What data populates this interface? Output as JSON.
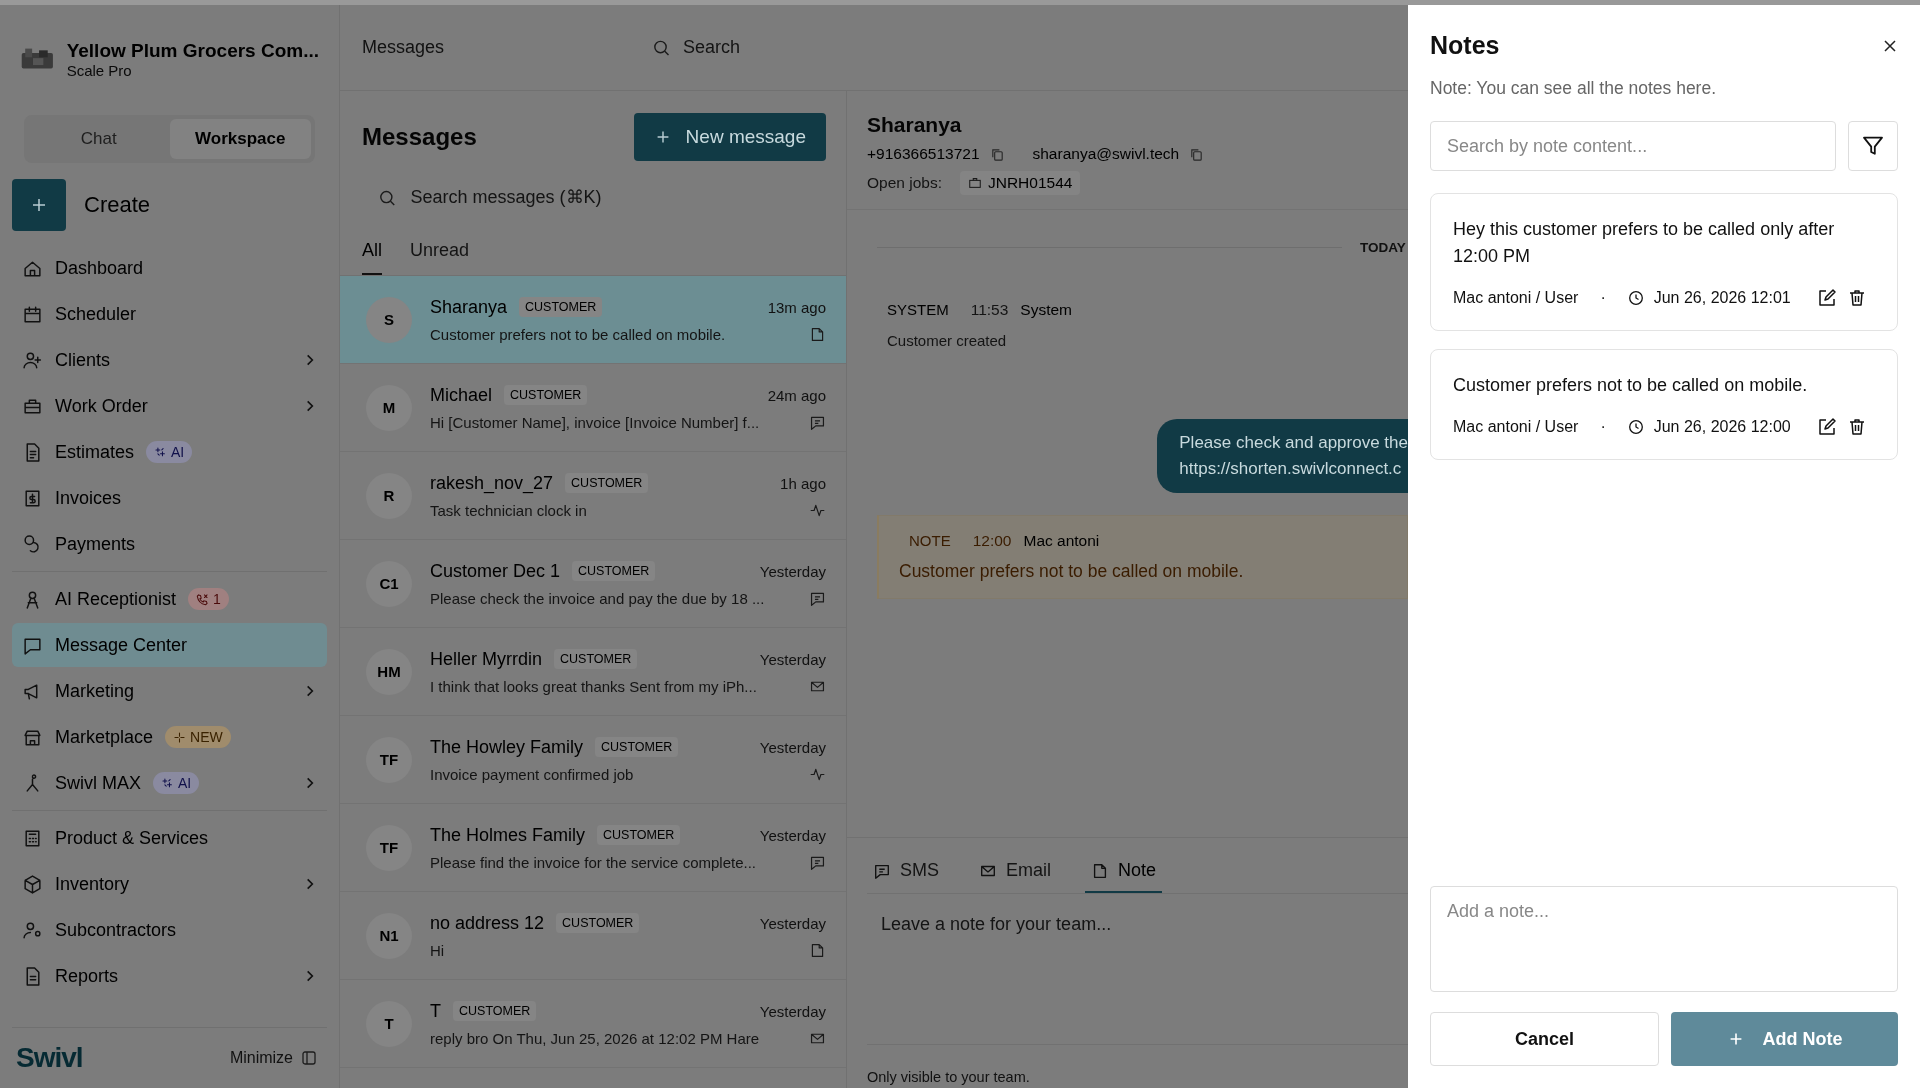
{
  "sidebar": {
    "company": {
      "name": "Yellow Plum Grocers Com...",
      "plan": "Scale Pro"
    },
    "mode_tabs": [
      {
        "label": "Chat",
        "selected": false
      },
      {
        "label": "Workspace",
        "selected": true
      }
    ],
    "create_button": "Create",
    "nav_groups": [
      [
        {
          "label": "Dashboard",
          "expandable": false,
          "selected": false
        },
        {
          "label": "Scheduler",
          "expandable": false,
          "selected": false
        },
        {
          "label": "Clients",
          "expandable": true,
          "selected": false
        },
        {
          "label": "Work Order",
          "expandable": true,
          "selected": false
        },
        {
          "label": "Estimates",
          "expandable": false,
          "selected": false,
          "badge": {
            "kind": "ai",
            "text": "AI"
          }
        },
        {
          "label": "Invoices",
          "expandable": false,
          "selected": false
        },
        {
          "label": "Payments",
          "expandable": false,
          "selected": false
        }
      ],
      [
        {
          "label": "AI Receptionist",
          "expandable": false,
          "selected": false,
          "badge": {
            "kind": "call",
            "text": "1"
          }
        },
        {
          "label": "Message Center",
          "expandable": false,
          "selected": true
        },
        {
          "label": "Marketing",
          "expandable": true,
          "selected": false
        },
        {
          "label": "Marketplace",
          "expandable": false,
          "selected": false,
          "badge": {
            "kind": "new",
            "text": "NEW"
          }
        },
        {
          "label": "Swivl MAX",
          "expandable": true,
          "selected": false,
          "badge": {
            "kind": "ai",
            "text": "AI"
          }
        }
      ],
      [
        {
          "label": "Product & Services",
          "expandable": false,
          "selected": false
        },
        {
          "label": "Inventory",
          "expandable": true,
          "selected": false
        },
        {
          "label": "Subcontractors",
          "expandable": false,
          "selected": false
        },
        {
          "label": "Reports",
          "expandable": true,
          "selected": false
        }
      ]
    ],
    "logo": "Swivl",
    "minimize": "Minimize"
  },
  "top_bar": {
    "breadcrumb": "Messages",
    "search": {
      "placeholder": "Search"
    }
  },
  "messages": {
    "title": "Messages",
    "new_button": "New message",
    "search": {
      "placeholder": "Search messages (⌘K)"
    },
    "filter_tabs": [
      {
        "label": "All",
        "selected": true
      },
      {
        "label": "Unread",
        "selected": false
      }
    ],
    "conversations": [
      {
        "initials": "S",
        "name": "Sharanya",
        "tag": "CUSTOMER",
        "time": "13m ago",
        "preview": "Customer prefers not to be called on mobile.",
        "kind": "note",
        "selected": true
      },
      {
        "initials": "M",
        "name": "Michael",
        "tag": "CUSTOMER",
        "time": "24m ago",
        "preview": "Hi [Customer Name], invoice [Invoice Number] f...",
        "kind": "sms",
        "selected": false
      },
      {
        "initials": "R",
        "name": "rakesh_nov_27",
        "tag": "CUSTOMER",
        "time": "1h ago",
        "preview": "Task technician clock in",
        "kind": "activity",
        "selected": false
      },
      {
        "initials": "C1",
        "name": "Customer Dec 1",
        "tag": "CUSTOMER",
        "time": "Yesterday",
        "preview": "Please check the invoice and pay the due by 18 ...",
        "kind": "sms",
        "selected": false
      },
      {
        "initials": "HM",
        "name": "Heller Myrrdin",
        "tag": "CUSTOMER",
        "time": "Yesterday",
        "preview": "I think that looks great thanks Sent from my iPh...",
        "kind": "email",
        "selected": false
      },
      {
        "initials": "TF",
        "name": "The Howley Family",
        "tag": "CUSTOMER",
        "time": "Yesterday",
        "preview": "Invoice payment confirmed job",
        "kind": "activity",
        "selected": false
      },
      {
        "initials": "TF",
        "name": "The Holmes Family",
        "tag": "CUSTOMER",
        "time": "Yesterday",
        "preview": "Please find the invoice for the service complete...",
        "kind": "sms",
        "selected": false
      },
      {
        "initials": "N1",
        "name": "no address 12",
        "tag": "CUSTOMER",
        "time": "Yesterday",
        "preview": "Hi",
        "kind": "note",
        "selected": false
      },
      {
        "initials": "T",
        "name": "T",
        "tag": "CUSTOMER",
        "time": "Yesterday",
        "preview": "reply bro On Thu, Jun 25, 2026 at 12:02 PM Hare",
        "kind": "email",
        "selected": false
      }
    ]
  },
  "conversation": {
    "contact": {
      "name": "Sharanya",
      "phone": "+916366513721",
      "email": "sharanya@swivl.tech",
      "open_jobs_label": "Open jobs:",
      "job": "JNRH01544"
    },
    "day_divider": "TODAY",
    "events": [
      {
        "kind": "system",
        "tag": "SYSTEM",
        "time": "11:53",
        "author": "System",
        "text": "Customer created"
      },
      {
        "kind": "outgoing",
        "lines": [
          "Please check and approve the",
          "https://shorten.swivlconnect.c"
        ]
      },
      {
        "kind": "note",
        "tag": "NOTE",
        "time": "12:00",
        "author": "Mac antoni",
        "text": "Customer prefers not to be called on mobile."
      }
    ],
    "composer_tabs": [
      {
        "label": "SMS",
        "kind": "sms",
        "selected": false
      },
      {
        "label": "Email",
        "kind": "email",
        "selected": false
      },
      {
        "label": "Note",
        "kind": "note",
        "selected": true
      }
    ],
    "composer": {
      "placeholder": "Leave a note for your team..."
    },
    "footnote": "Only visible to your team."
  },
  "notes_panel": {
    "title": "Notes",
    "subtitle": "Note: You can see all the notes here.",
    "search": {
      "placeholder": "Search by note content..."
    },
    "notes": [
      {
        "text": "Hey this customer prefers to be called only after 12:00 PM",
        "author": "Mac antoni / User",
        "separator": "·",
        "date": "Jun 26, 2026 12:01"
      },
      {
        "text": "Customer prefers not to be called on mobile.",
        "author": "Mac antoni / User",
        "separator": "·",
        "date": "Jun 26, 2026 12:00"
      }
    ],
    "add_field": {
      "placeholder": "Add a note..."
    },
    "cancel_button": "Cancel",
    "add_button": {
      "label": "Add Note",
      "disabled": true
    }
  }
}
